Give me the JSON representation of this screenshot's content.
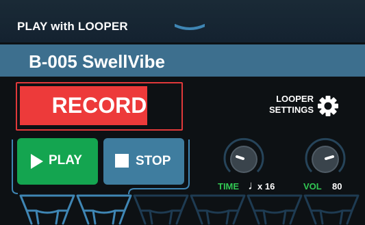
{
  "header": {
    "title": "PLAY with LOOPER",
    "collapse_icon": "chevron-down-icon"
  },
  "patch": {
    "name": "B-005 SwellVibe"
  },
  "record": {
    "label": "RECORD",
    "progress": 0.8,
    "color": "#ed3a3a"
  },
  "looper_settings": {
    "label_line1": "LOOPER",
    "label_line2": "SETTINGS",
    "icon": "gear-icon"
  },
  "buttons": {
    "play_label": "PLAY",
    "play_color": "#14a550",
    "stop_label": "STOP",
    "stop_color": "#3f7d9f"
  },
  "knobs": {
    "time_label": "TIME",
    "time_note_icon": "quarter-note-icon",
    "time_note": "♩",
    "time_value": "x 16",
    "vol_label": "VOL",
    "vol_value": "80",
    "label_color": "#31c853"
  },
  "footswitches": {
    "count": 6,
    "active_count": 2,
    "active_color": "#3f86b4",
    "inactive_color": "#1e3b52"
  }
}
